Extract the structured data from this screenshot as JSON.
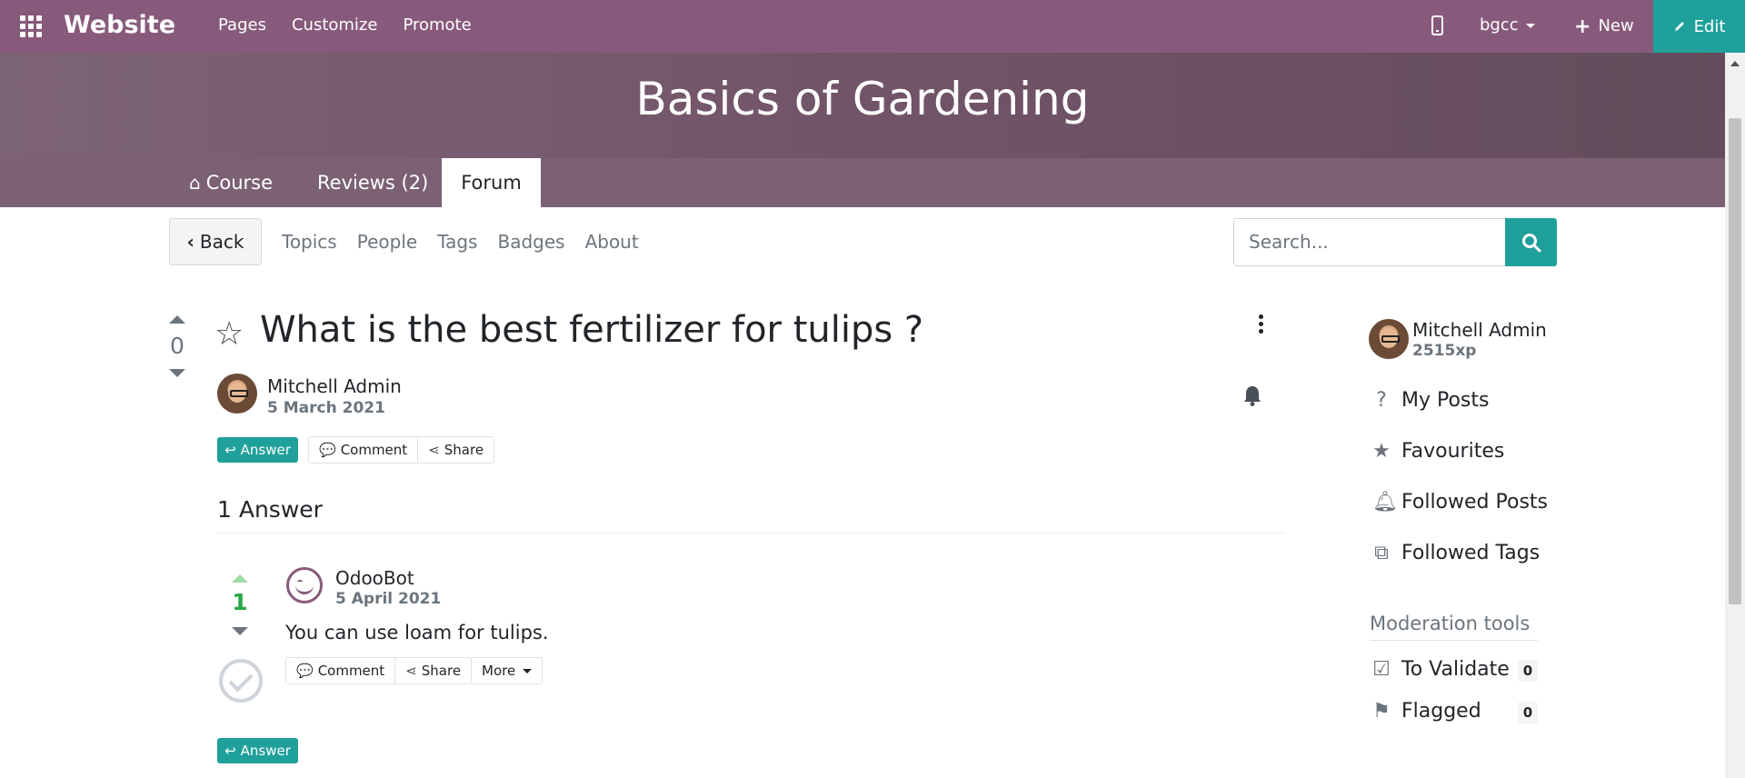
{
  "topbar": {
    "brand": "Website",
    "menu": [
      "Pages",
      "Customize",
      "Promote"
    ],
    "user": "bgcc",
    "new_label": "New",
    "edit_label": "Edit",
    "color": "#875a7b",
    "accent": "#20a09b"
  },
  "course": {
    "title": "Basics of Gardening",
    "tabs": [
      "Course",
      "Reviews (2)",
      "Forum"
    ],
    "active_tab": "Forum"
  },
  "forum_nav": {
    "back_label": "Back",
    "links": [
      "Topics",
      "People",
      "Tags",
      "Badges",
      "About"
    ],
    "search_placeholder": "Search..."
  },
  "question": {
    "votes": "0",
    "title": "What is the best fertilizer for tulips ?",
    "author": "Mitchell Admin",
    "date": "5 March 2021",
    "answer_label": "Answer",
    "comment_label": "Comment",
    "share_label": "Share"
  },
  "answers": {
    "count_label": "1 Answer",
    "items": [
      {
        "votes": "1",
        "author": "OdooBot",
        "date": "5 April 2021",
        "text": "You can use loam for tulips.",
        "comment_label": "Comment",
        "share_label": "Share",
        "more_label": "More"
      }
    ],
    "answer_label": "Answer"
  },
  "sidebar": {
    "user_name": "Mitchell Admin",
    "xp": "2515xp",
    "items": [
      "My Posts",
      "Favourites",
      "Followed Posts",
      "Followed Tags"
    ],
    "moderation_title": "Moderation tools",
    "to_validate_label": "To Validate",
    "to_validate_count": "0",
    "flagged_label": "Flagged",
    "flagged_count": "0"
  }
}
